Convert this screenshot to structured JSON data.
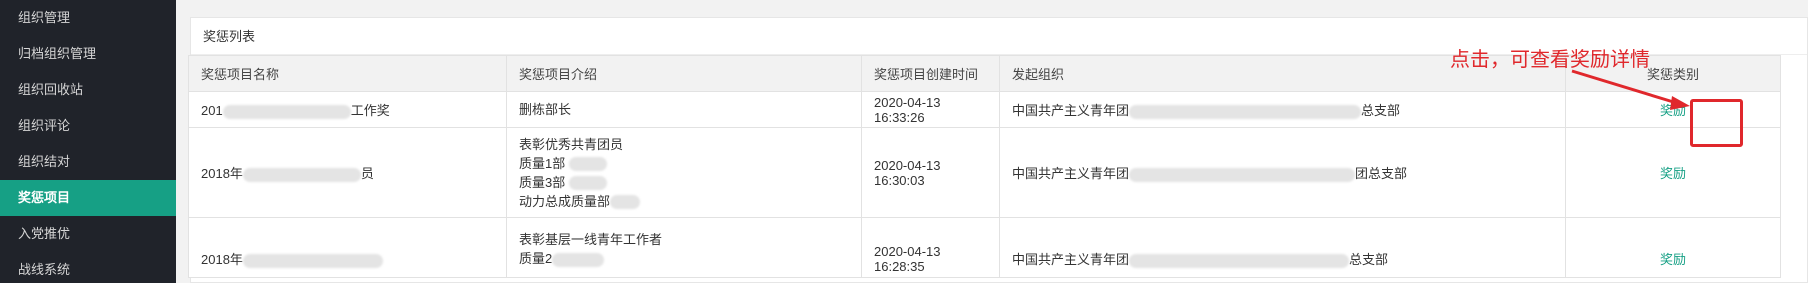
{
  "sidebar": {
    "items": [
      {
        "label": "组织管理",
        "active": false
      },
      {
        "label": "归档组织管理",
        "active": false
      },
      {
        "label": "组织回收站",
        "active": false
      },
      {
        "label": "组织评论",
        "active": false
      },
      {
        "label": "组织结对",
        "active": false
      },
      {
        "label": "奖惩项目",
        "active": true
      },
      {
        "label": "入党推优",
        "active": false
      },
      {
        "label": "战线系统",
        "active": false
      }
    ]
  },
  "card": {
    "title": "奖惩列表"
  },
  "table": {
    "headers": {
      "name": "奖惩项目名称",
      "intro": "奖惩项目介绍",
      "created": "奖惩项目创建时间",
      "org": "发起组织",
      "category": "奖惩类别"
    },
    "rows": [
      {
        "name_prefix": "201",
        "name_suffix": "工作奖",
        "intro": [
          "删栋部长"
        ],
        "created": "2020-04-13 16:33:26",
        "org_prefix": "中国共产主义青年团",
        "org_suffix": "总支部",
        "action": "奖励"
      },
      {
        "name_prefix": "2018年",
        "name_suffix": "员",
        "intro": [
          "表彰优秀共青团员",
          "质量1部",
          "质量3部",
          "动力总成质量部"
        ],
        "created": "2020-04-13 16:30:03",
        "org_prefix": "中国共产主义青年团",
        "org_suffix": "团总支部",
        "action": "奖励"
      },
      {
        "name_prefix": "2018年",
        "name_suffix": "",
        "intro": [
          "表彰基层一线青年工作者",
          "质量2"
        ],
        "created": "2020-04-13 16:28:35",
        "org_prefix": "中国共产主义青年团",
        "org_suffix": "总支部",
        "action": "奖励"
      }
    ]
  },
  "annotation": {
    "text": "点击，可查看奖励详情",
    "color": "#e0282c"
  },
  "colors": {
    "accent": "#16a085",
    "sidebar_bg": "#20232a"
  }
}
